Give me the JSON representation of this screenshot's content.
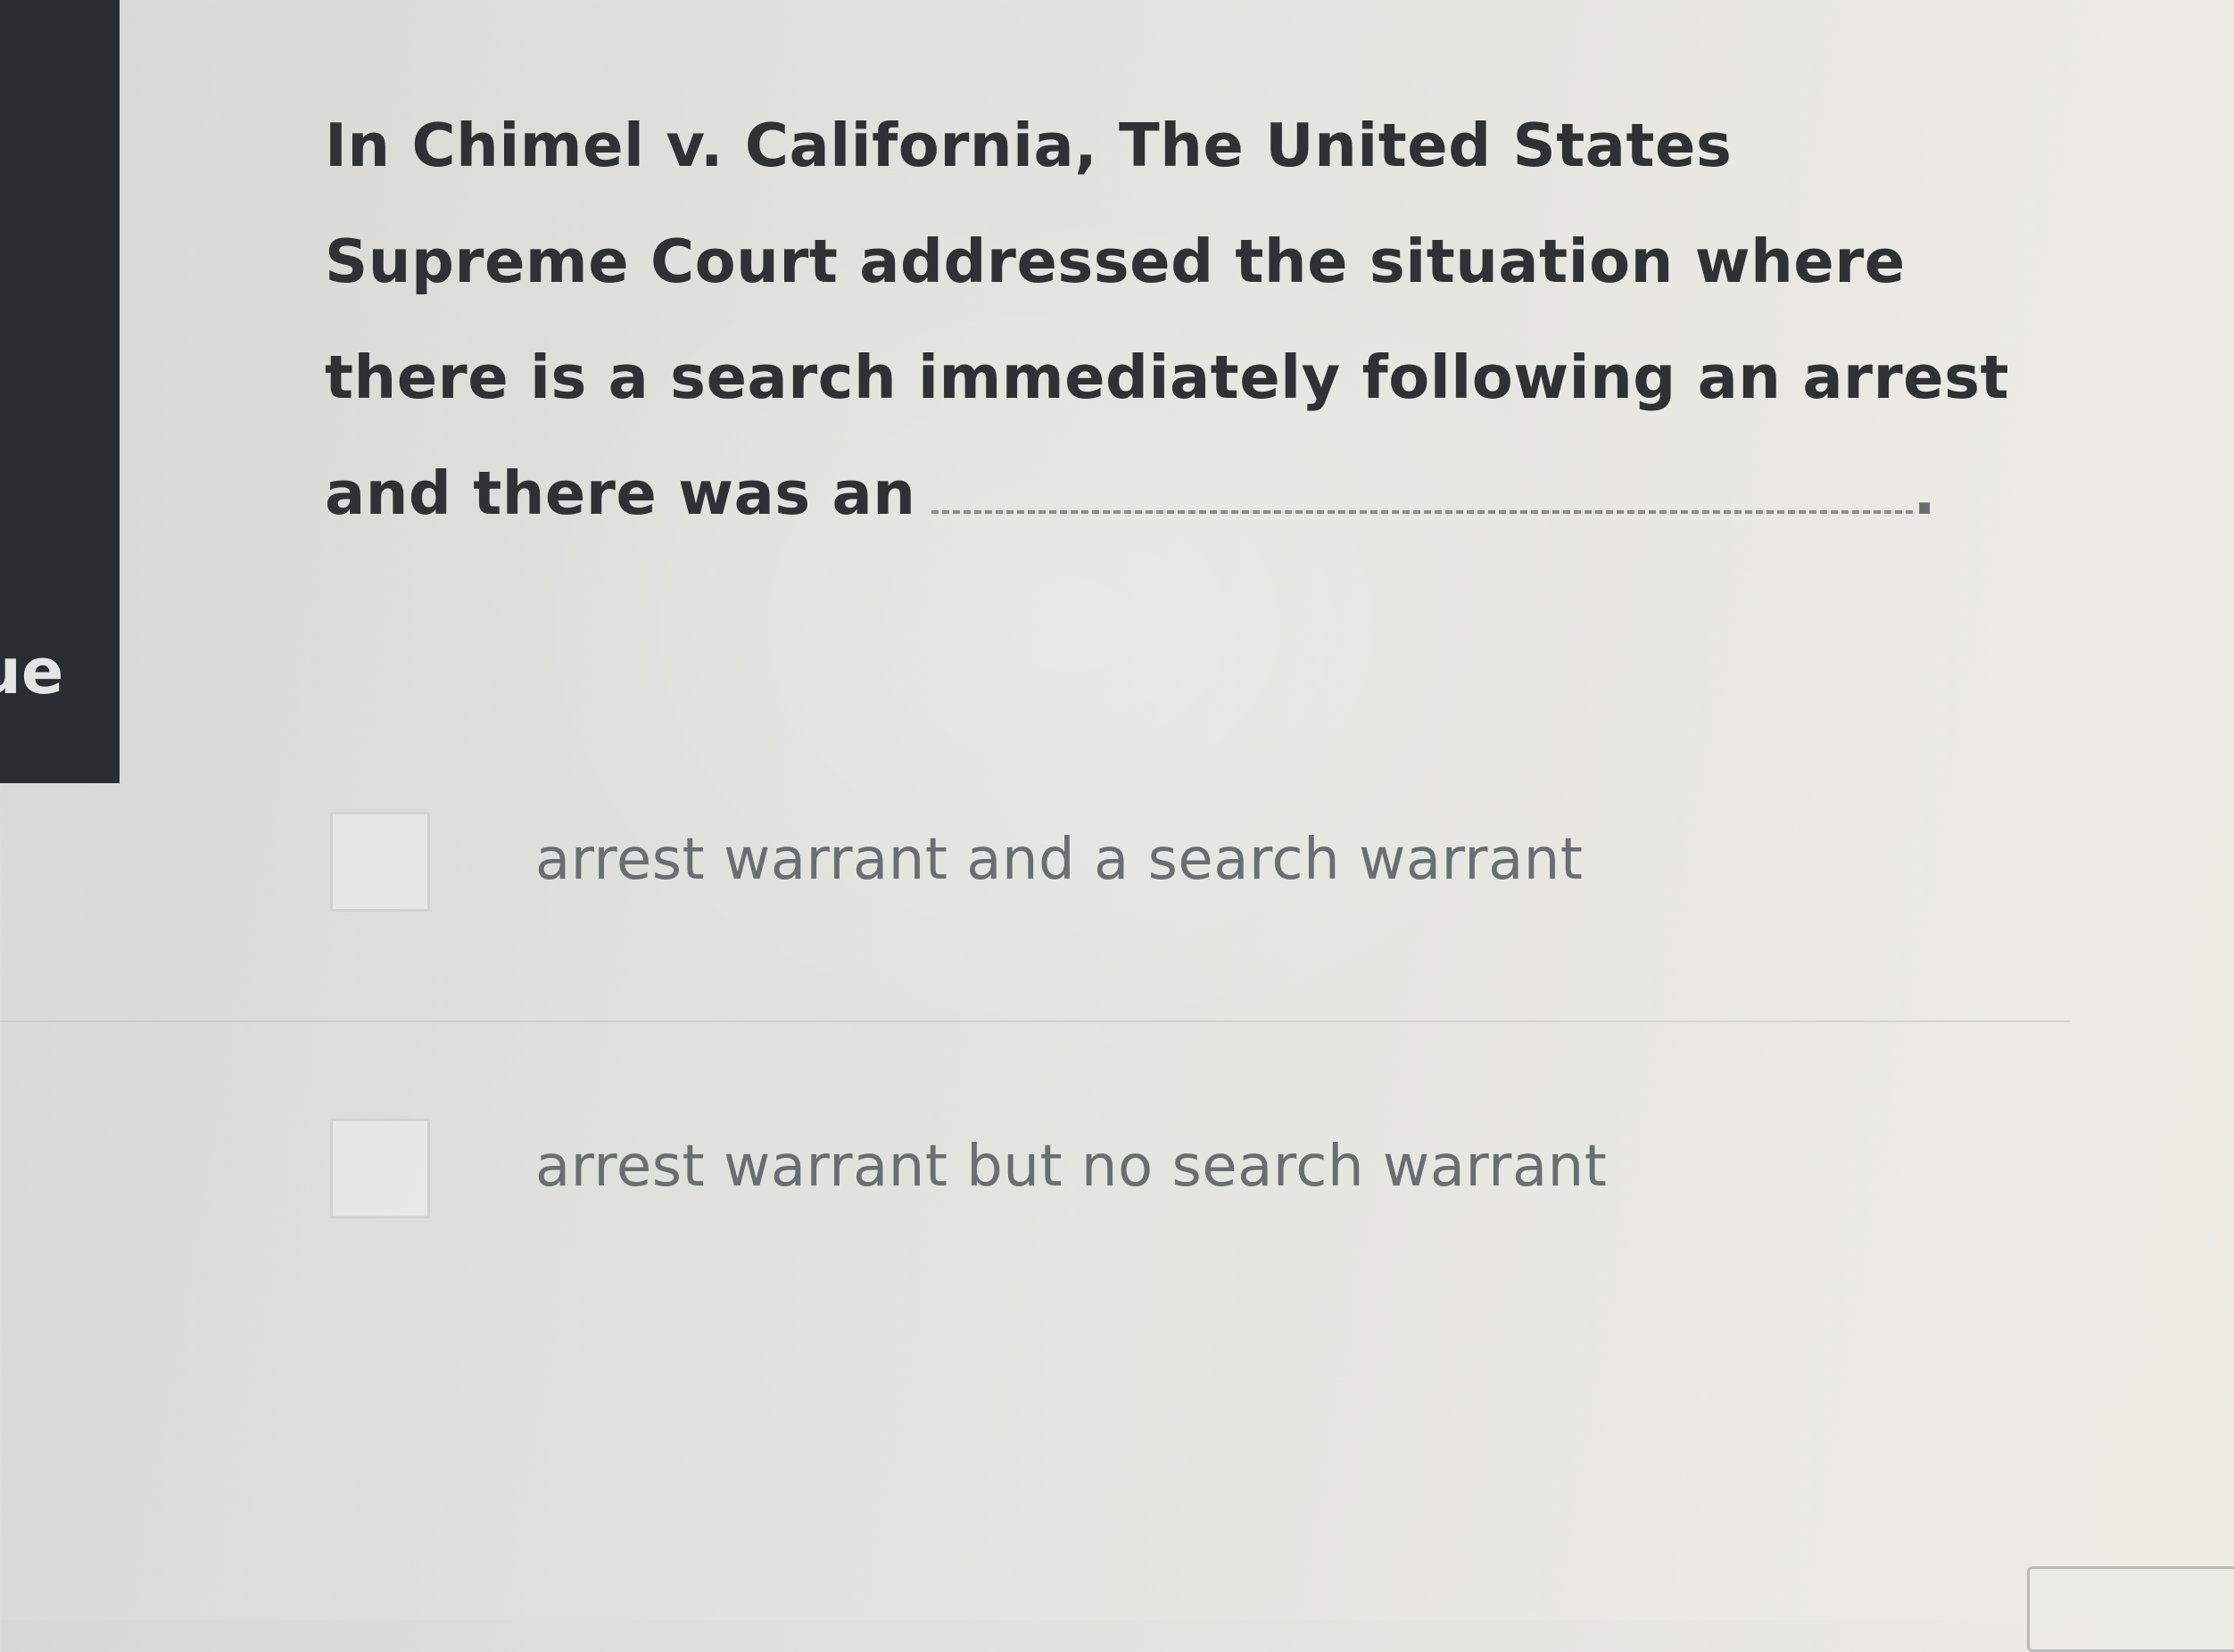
{
  "sidebar": {
    "partial_text": "ue"
  },
  "question": {
    "text": "In Chimel v. California, The United States Supreme Court addressed the situation where there is a search immediately following an arrest and there was an",
    "end_punctuation": "."
  },
  "options": [
    {
      "label": "arrest warrant and a search warrant",
      "checked": false
    },
    {
      "label": "arrest warrant but no search warrant",
      "checked": false
    }
  ],
  "colors": {
    "sidebar_background": "#2a2d31",
    "question_text": "#2f3134",
    "option_text": "#6a6d71"
  }
}
